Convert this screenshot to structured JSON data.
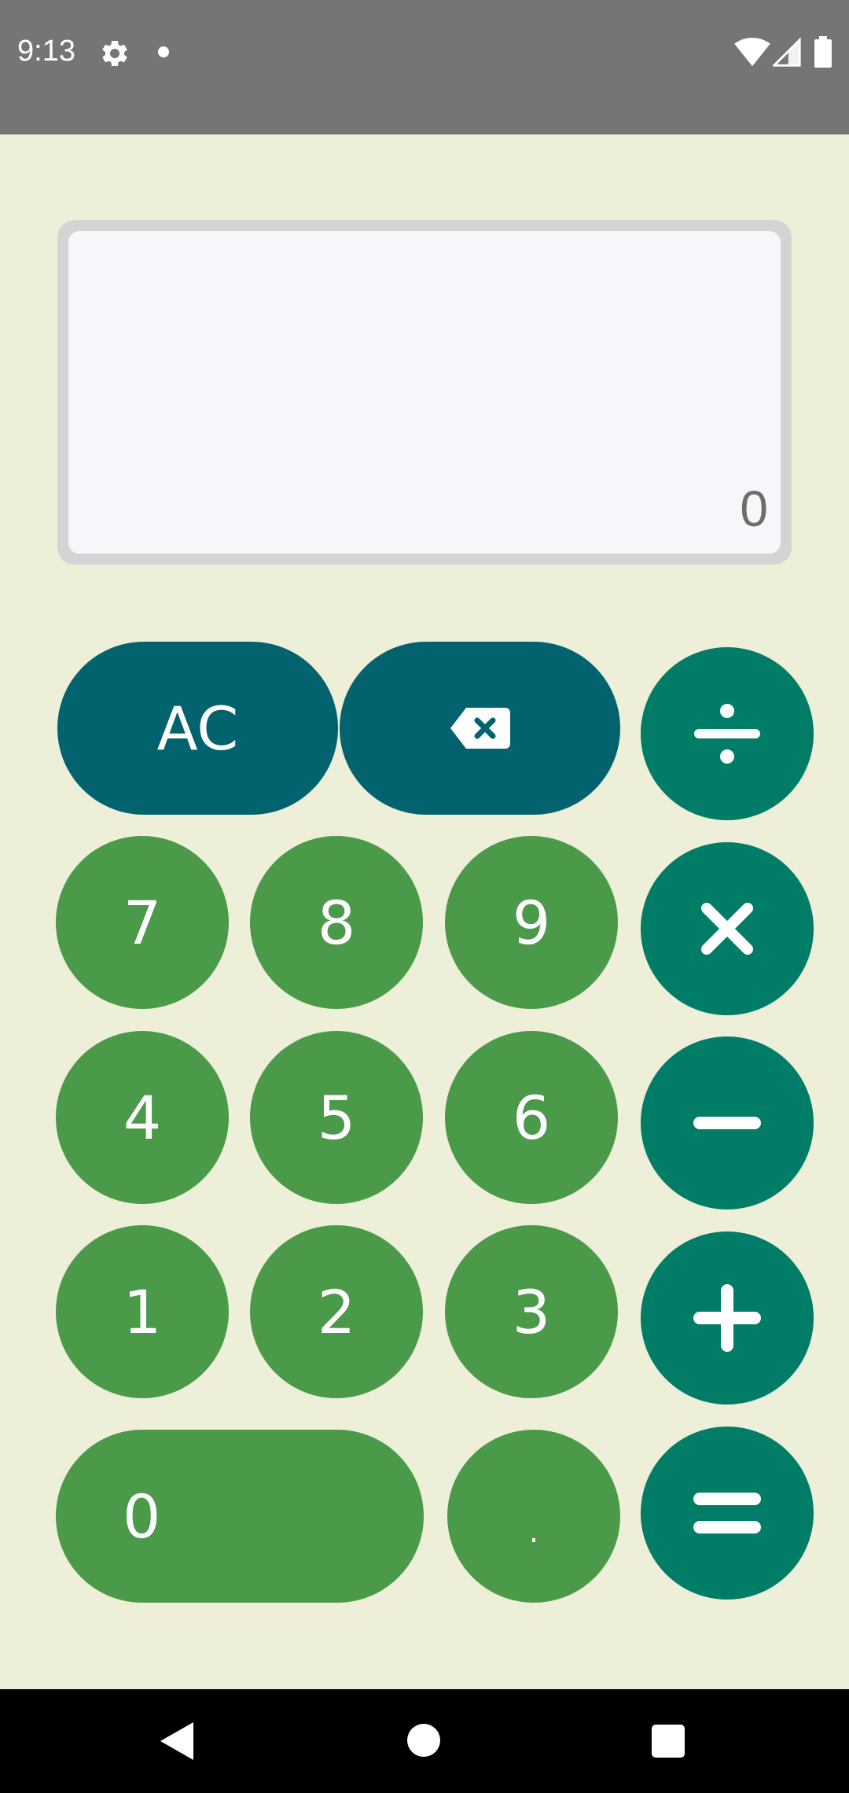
{
  "status_bar": {
    "time": "9:13",
    "icons": [
      "settings-icon",
      "notification-dot",
      "wifi-icon",
      "cell-signal-icon",
      "battery-icon"
    ]
  },
  "display": {
    "value": "0"
  },
  "keypad": {
    "clear": "AC",
    "backspace_icon": "backspace-icon",
    "divide_icon": "divide-icon",
    "multiply_icon": "multiply-icon",
    "subtract_icon": "minus-icon",
    "add_icon": "plus-icon",
    "equals_icon": "equals-icon",
    "digits": {
      "d7": "7",
      "d8": "8",
      "d9": "9",
      "d4": "4",
      "d5": "5",
      "d6": "6",
      "d1": "1",
      "d2": "2",
      "d3": "3",
      "d0": "0",
      "decimal": "."
    }
  },
  "nav_bar": {
    "icons": [
      "back-icon",
      "home-icon",
      "recents-icon"
    ]
  },
  "colors": {
    "background": "#EEEFD9",
    "status_bar": "#757575",
    "digit_button": "#4B9A4A",
    "operator_button": "#007C67",
    "top_button": "#02636F",
    "display_bg": "#F6F7FB",
    "display_border": "#D4D4D4"
  }
}
